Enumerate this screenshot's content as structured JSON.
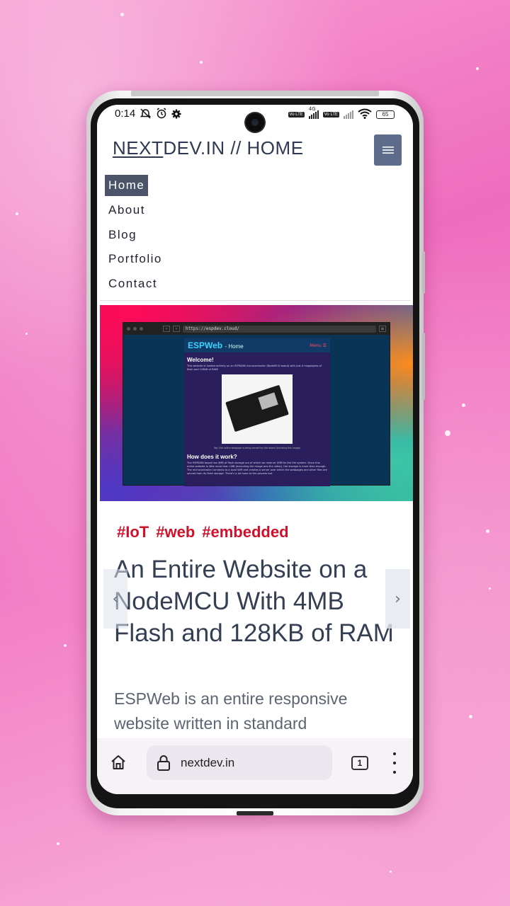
{
  "status_bar": {
    "time": "0:14",
    "network": "4G",
    "lte_label": "Vo LTE",
    "battery": "65"
  },
  "site": {
    "title_underlined": "NEXT",
    "title_rest": "DEV.IN // HOME"
  },
  "nav": {
    "items": [
      {
        "label": "Home",
        "active": true
      },
      {
        "label": "About"
      },
      {
        "label": "Blog"
      },
      {
        "label": "Portfolio"
      },
      {
        "label": "Contact"
      }
    ]
  },
  "hero": {
    "browser_url_prefix": "https://",
    "browser_url_rest": "espdev.cloud/",
    "esp_logo": "ESPWeb",
    "esp_logo_suffix": "- Home",
    "esp_menu": "Menu ☰",
    "esp_welcome": "Welcome!",
    "esp_intro": "This website is hosted entirely on an ESP8266 microcontroller (NodeMCU board) with just 4 megabytes of flash and 128KB of RAM!",
    "esp_caption": "Yep, this entire webpage is being served by this board (including this image)",
    "esp_how": "How does it work?",
    "esp_how_text": "The ESP8266 board has 4MB of flash storage out of which we reserve 1MB for the file system. Since this entire website is little more than 1MB (excluding the image and the video), the storage is more than enough. The microcontroller connects to a local WiFi and creates a server over which the webpages and other files are served from its flash storage. There's a lot more to the process but"
  },
  "article": {
    "tags": [
      "#IoT",
      "#web",
      "#embedded"
    ],
    "title": "An Entire Website on a NodeMCU With 4MB Flash and 128KB of RAM",
    "excerpt": "ESPWeb is an entire responsive website written in standard"
  },
  "carousel": {
    "prev_glyph": "‹",
    "next_glyph": "›"
  },
  "toolbar": {
    "url": "nextdev.in",
    "tab_count": "1"
  },
  "icons": [
    "do-not-disturb-icon",
    "alarm-icon",
    "settings-icon",
    "wifi-icon",
    "signal-icon",
    "battery-icon",
    "hamburger-menu-icon",
    "home-icon",
    "lock-icon",
    "tabs-icon",
    "more-vert-icon"
  ],
  "colors": {
    "accent_red": "#d1112b",
    "nav_active_bg": "#4b5468",
    "menu_button_bg": "#5d6c8a",
    "title_text": "#343f53"
  }
}
